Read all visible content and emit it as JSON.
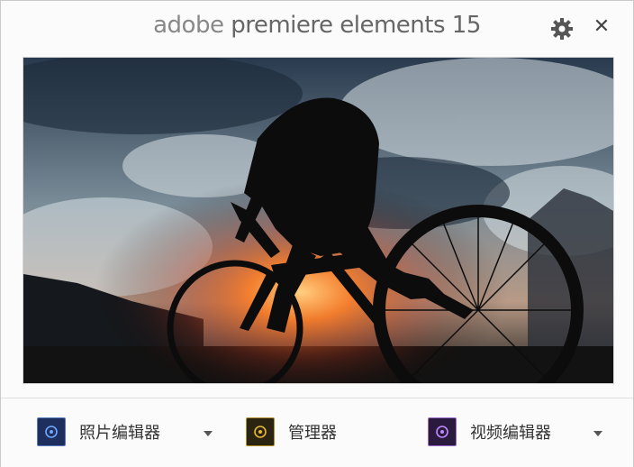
{
  "window": {
    "title_brand": "adobe",
    "title_product": "premiere elements 15",
    "settings_icon": "gear-icon",
    "close_icon": "close-icon",
    "close_glyph": "✕"
  },
  "launchers": [
    {
      "label": "照片编辑器",
      "icon": "photo-editor-icon",
      "color": "#2c4a8a",
      "has_dropdown": true
    },
    {
      "label": "管理器",
      "icon": "organizer-icon",
      "color": "#6b5a1e",
      "has_dropdown": false
    },
    {
      "label": "视频编辑器",
      "icon": "video-editor-icon",
      "color": "#4a2c6a",
      "has_dropdown": true
    }
  ],
  "colors": {
    "photo_icon_bg": "#1e2f5e",
    "organizer_icon_bg": "#2a2410",
    "video_icon_bg": "#2a1a3e"
  }
}
